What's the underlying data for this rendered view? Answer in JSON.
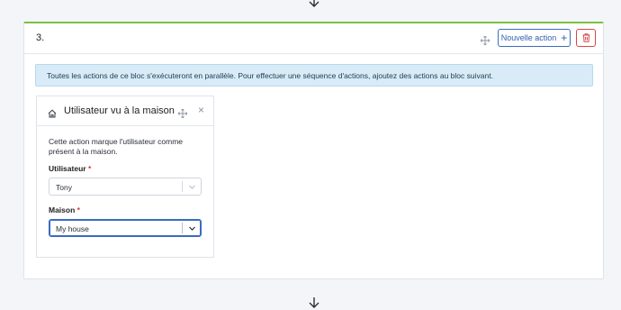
{
  "block": {
    "number": "3.",
    "new_action_label": "Nouvelle action",
    "info_message": "Toutes les actions de ce bloc s'exécuteront en parallèle. Pour effectuer une séquence d'actions, ajoutez des actions au bloc suivant."
  },
  "action_card": {
    "title": "Utilisateur vu à la maison",
    "description": "Cette action marque l'utilisateur comme présent à la maison.",
    "fields": [
      {
        "label": "Utilisateur",
        "required_mark": "*",
        "value": "Tony"
      },
      {
        "label": "Maison",
        "required_mark": "*",
        "value": "My house"
      }
    ]
  },
  "icons": [
    "arrow-down-icon",
    "move-icon",
    "plus-icon",
    "trash-icon",
    "home-icon",
    "close-icon",
    "chevron-down-icon"
  ],
  "colors": {
    "accent_green": "#7ac142",
    "primary_blue": "#3a6bbf",
    "danger_red": "#d94646",
    "info_bg": "#d8ebf7"
  }
}
